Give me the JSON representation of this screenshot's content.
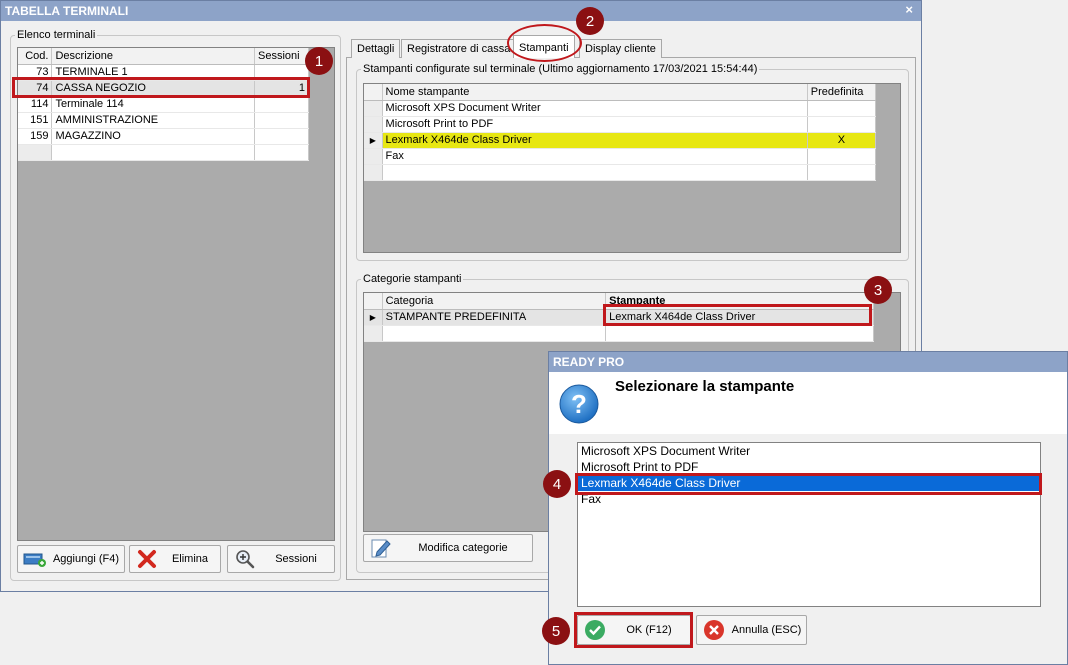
{
  "main_window": {
    "title": "TABELLA TERMINALI",
    "close": "×"
  },
  "terminals": {
    "group_label": "Elenco terminali",
    "columns": [
      "Cod.",
      "Descrizione",
      "Sessioni"
    ],
    "rows": [
      {
        "cod": "73",
        "desc": "TERMINALE 1",
        "sessioni": ""
      },
      {
        "cod": "74",
        "desc": "CASSA NEGOZIO",
        "sessioni": "1"
      },
      {
        "cod": "114",
        "desc": "Terminale 114",
        "sessioni": ""
      },
      {
        "cod": "151",
        "desc": "AMMINISTRAZIONE",
        "sessioni": ""
      },
      {
        "cod": "159",
        "desc": "MAGAZZINO",
        "sessioni": ""
      }
    ],
    "buttons": {
      "add": "Aggiungi (F4)",
      "delete": "Elimina",
      "sessions": "Sessioni"
    }
  },
  "tabs": [
    "Dettagli",
    "Registratore di cassa",
    "Stampanti",
    "Display cliente"
  ],
  "printers": {
    "group_label": "Stampanti configurate sul terminale (Ultimo aggiornamento 17/03/2021 15:54:44)",
    "columns": [
      "Nome stampante",
      "Predefinita"
    ],
    "rows": [
      {
        "name": "Microsoft XPS Document Writer",
        "default": ""
      },
      {
        "name": "Microsoft Print to PDF",
        "default": ""
      },
      {
        "name": "Lexmark X464de Class Driver",
        "default": "X"
      },
      {
        "name": "Fax",
        "default": ""
      }
    ]
  },
  "categories": {
    "group_label": "Categorie stampanti",
    "columns": [
      "Categoria",
      "Stampante"
    ],
    "rows": [
      {
        "category": "STAMPANTE PREDEFINITA",
        "printer": "Lexmark X464de Class Driver"
      }
    ],
    "edit_button": "Modifica categorie"
  },
  "dialog": {
    "title": "READY PRO",
    "heading": "Selezionare la stampante",
    "items": [
      "Microsoft XPS Document Writer",
      "Microsoft Print to PDF",
      "Lexmark X464de Class Driver",
      "Fax"
    ],
    "ok": "OK (F12)",
    "cancel": "Annulla (ESC)"
  },
  "callouts": [
    "1",
    "2",
    "3",
    "4",
    "5"
  ],
  "colors": {
    "titlebar": "#8da3c8",
    "callout": "#8b1012",
    "highlight_yellow": "#e7e713",
    "selection_blue": "#0a6ad8",
    "red_outline": "#c0181c"
  }
}
